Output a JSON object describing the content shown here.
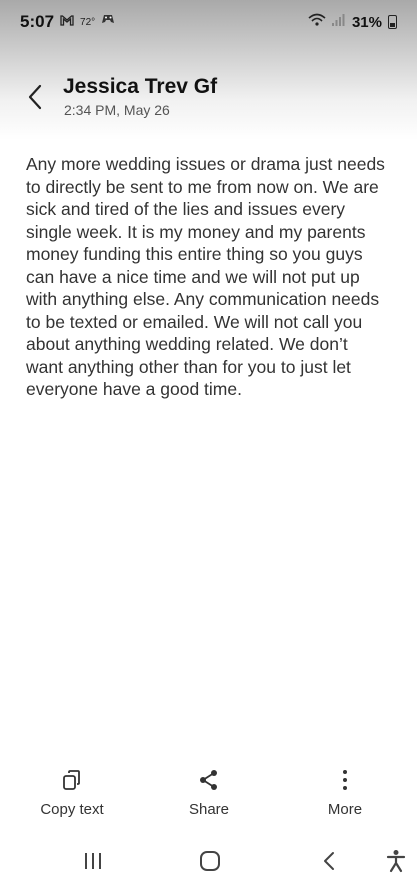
{
  "status_bar": {
    "time": "5:07",
    "temperature": "72°",
    "battery": "31%",
    "icons": [
      "gmail-icon",
      "game-controller-icon",
      "wifi-calling-icon",
      "signal-icon",
      "battery-icon"
    ]
  },
  "header": {
    "title": "Jessica Trev Gf",
    "timestamp": "2:34 PM, May 26"
  },
  "message": {
    "text": "Any more wedding issues or drama just needs to directly be sent to me from now on. We are sick and tired of the lies and issues every single week. It is my money and my parents money funding this entire thing so you guys can have a nice time and we will not put up with anything else. Any communication needs to be texted or emailed. We will not call you about anything wedding related. We don’t want anything other than for you to just let everyone have a good time."
  },
  "actions": {
    "copy_label": "Copy text",
    "share_label": "Share",
    "more_label": "More"
  },
  "navbar": {
    "buttons": [
      "recent-apps",
      "home",
      "back",
      "accessibility"
    ]
  }
}
